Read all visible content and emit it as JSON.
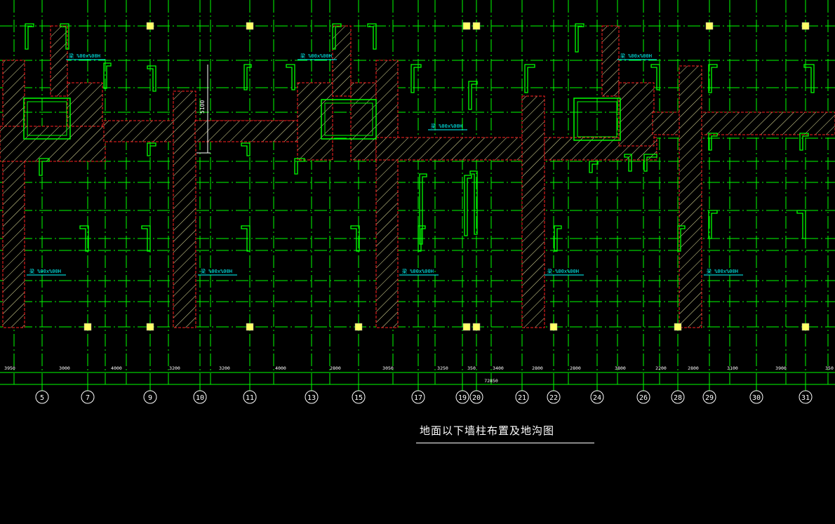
{
  "drawing": {
    "title": "地面以下墙柱布置及地沟图",
    "total_dim": "72850",
    "vertical_dim": "5100",
    "axes": [
      {
        "label": "5"
      },
      {
        "label": "7"
      },
      {
        "label": "9"
      },
      {
        "label": "10"
      },
      {
        "label": "11"
      },
      {
        "label": "13"
      },
      {
        "label": "15"
      },
      {
        "label": "17"
      },
      {
        "label": "19"
      },
      {
        "label": "20"
      },
      {
        "label": "21"
      },
      {
        "label": "22"
      },
      {
        "label": "24"
      },
      {
        "label": "26"
      },
      {
        "label": "28"
      },
      {
        "label": "29"
      },
      {
        "label": "30"
      },
      {
        "label": "31"
      }
    ],
    "spans": [
      "3950",
      "3000",
      "4000",
      "3200",
      "3200",
      "4000",
      "2800",
      "3050",
      "3250",
      "350",
      "3400",
      "2800",
      "2800",
      "3800",
      "2200",
      "2800",
      "3100",
      "3900",
      "350"
    ],
    "beam_labels": [
      "梁 %00x%00H",
      "梁 %00x%00H",
      "梁 %00x%00H",
      "梁 %00x%00H",
      "梁 %00x%00H",
      "梁 %00x%00H",
      "梁 %00x%00H",
      "梁 %00x%00H",
      "梁 %00x%00H"
    ],
    "colors": {
      "background": "#000000",
      "grid": "#00ff00",
      "wall_outline": "#ff2020",
      "hatch": "#e8e8a0",
      "column": "#00ff00",
      "annotation": "#00ffff",
      "pad": "#ffff66",
      "text": "#ffffff"
    }
  }
}
